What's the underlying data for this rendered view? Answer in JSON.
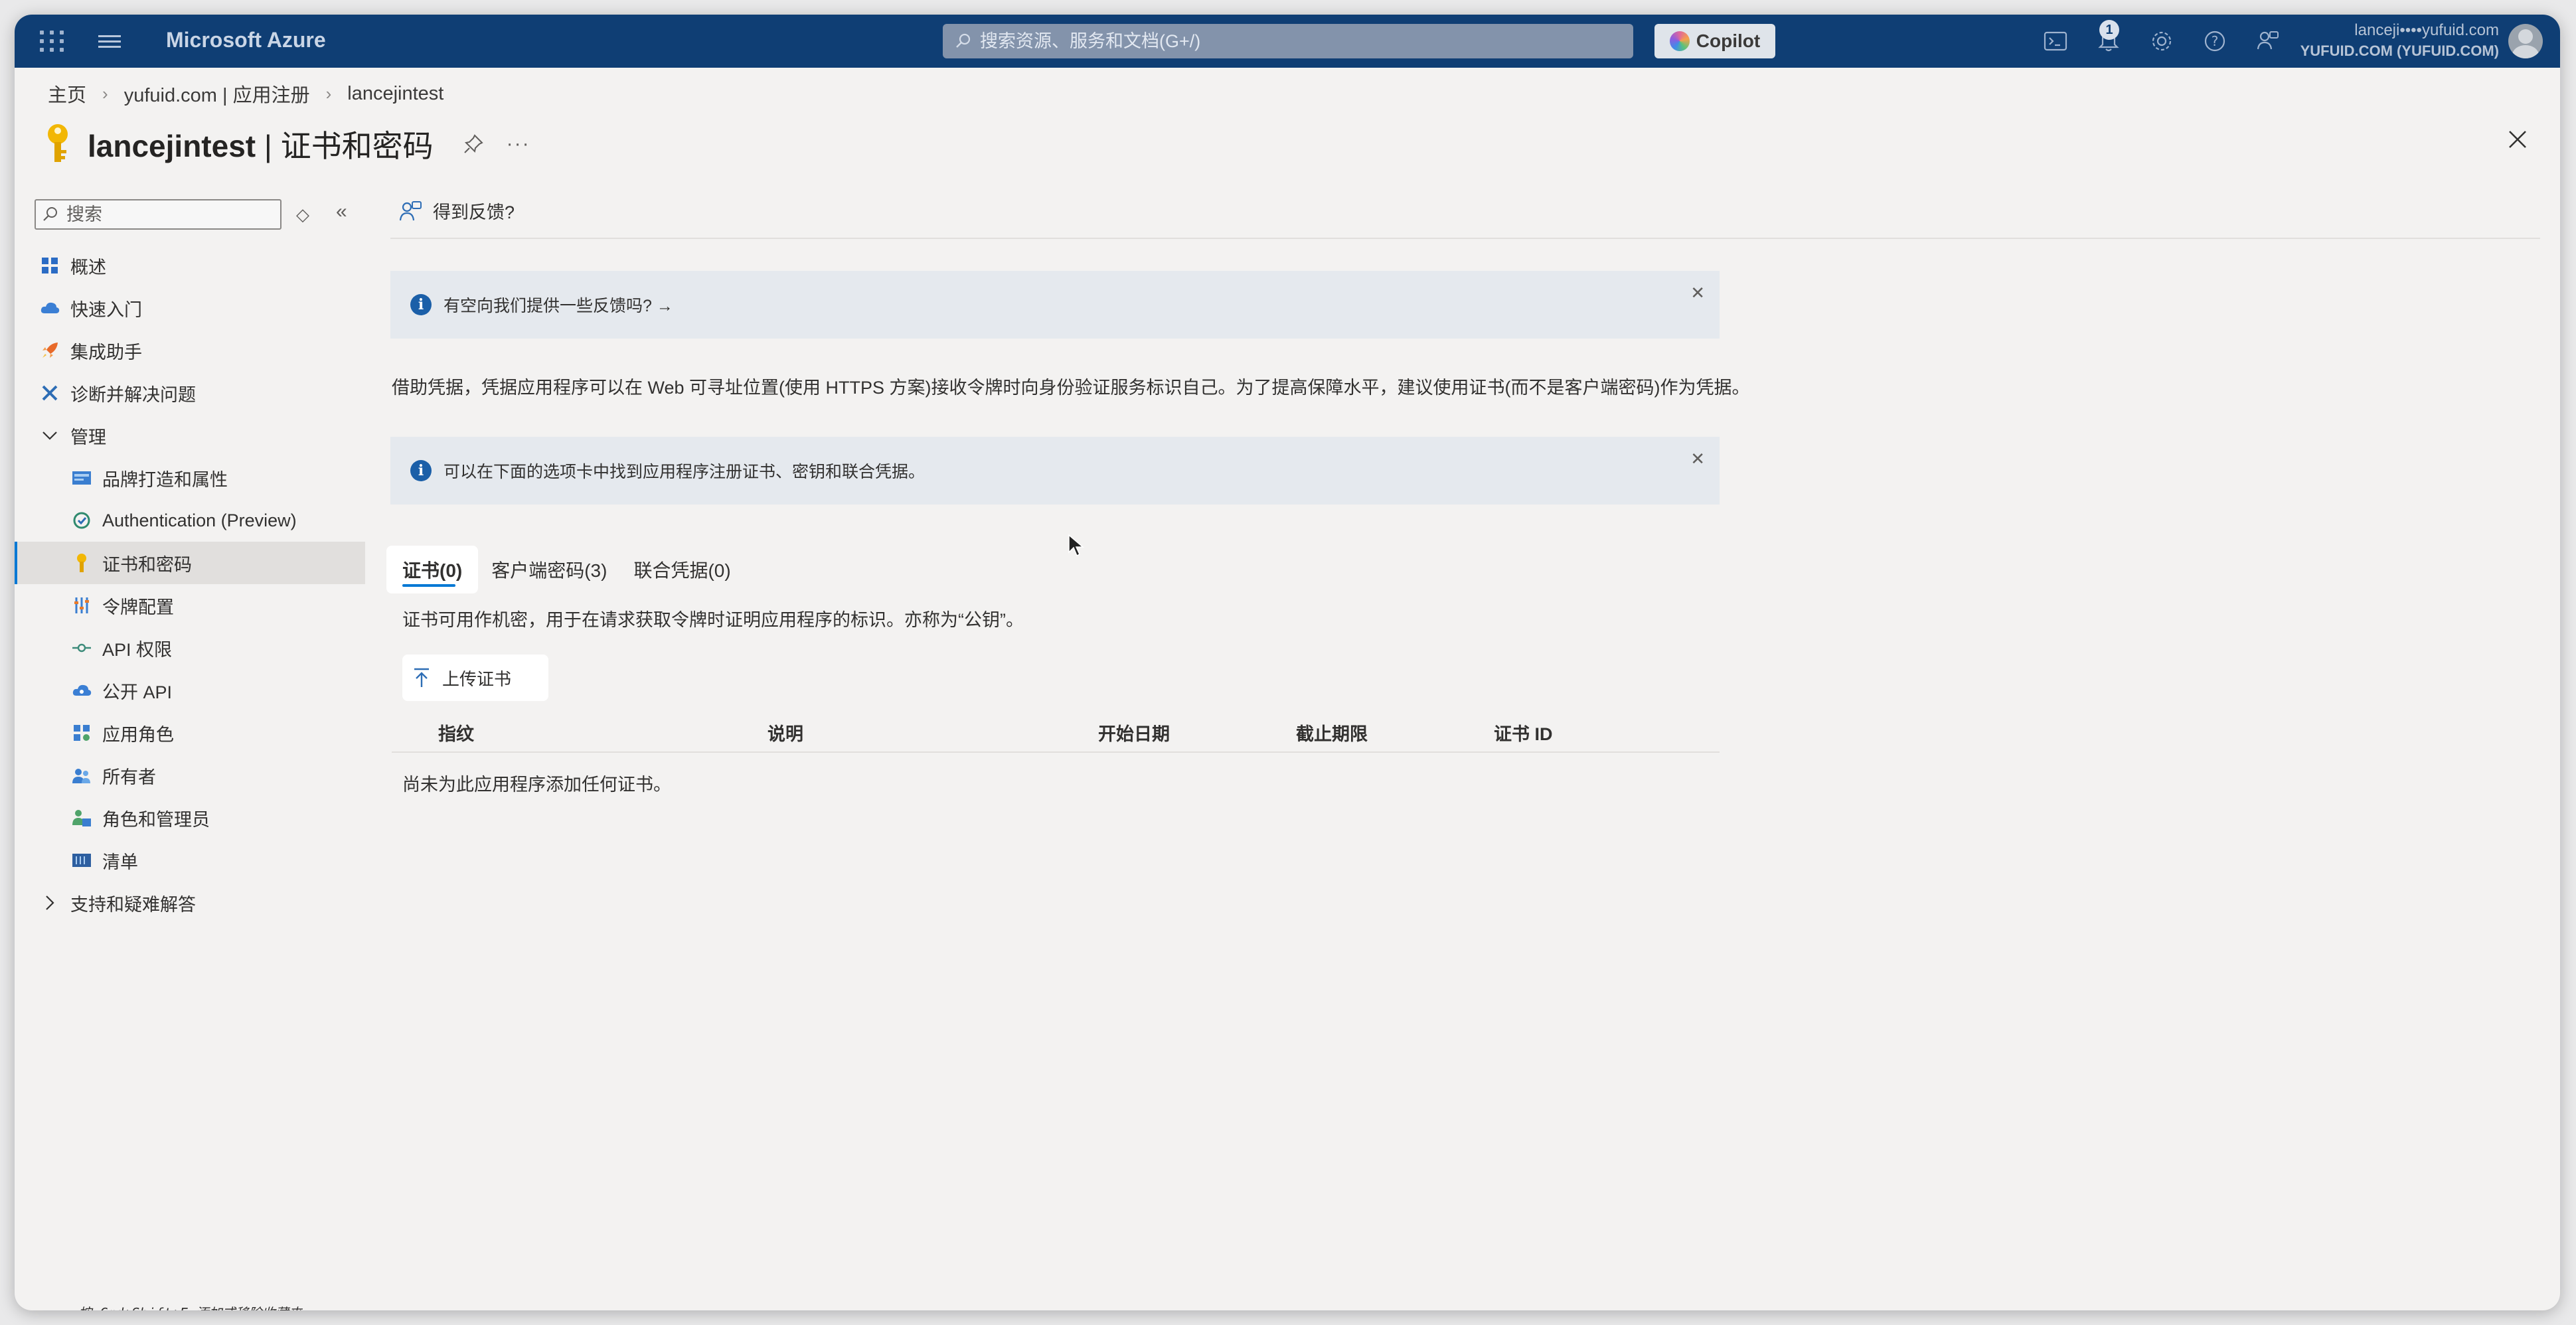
{
  "topbar": {
    "brand": "Microsoft Azure",
    "search_placeholder": "搜索资源、服务和文档(G+/)",
    "copilot_label": "Copilot",
    "notification_count": "1",
    "account_line1": "lanceji••••yufuid.com",
    "account_line2": "YUFUID.COM (YUFUID.COM)"
  },
  "breadcrumb": [
    "主页",
    "yufuid.com | 应用注册",
    "lancejintest"
  ],
  "page": {
    "title_app": "lancejintest",
    "title_section": " | 证书和密码"
  },
  "sidebar": {
    "search_placeholder": "搜索",
    "items": [
      {
        "label": "概述",
        "icon": "grid-icon"
      },
      {
        "label": "快速入门",
        "icon": "cloud-icon"
      },
      {
        "label": "集成助手",
        "icon": "rocket-icon"
      },
      {
        "label": "诊断并解决问题",
        "icon": "wrench-icon"
      },
      {
        "label": "管理",
        "icon": "chevron-down-icon"
      },
      {
        "label": "品牌打造和属性",
        "icon": "branding-icon"
      },
      {
        "label": "Authentication (Preview)",
        "icon": "auth-icon"
      },
      {
        "label": "证书和密码",
        "icon": "key-icon"
      },
      {
        "label": "令牌配置",
        "icon": "token-icon"
      },
      {
        "label": "API 权限",
        "icon": "api-permission-icon"
      },
      {
        "label": "公开 API",
        "icon": "cloud-api-icon"
      },
      {
        "label": "应用角色",
        "icon": "app-roles-icon"
      },
      {
        "label": "所有者",
        "icon": "owners-icon"
      },
      {
        "label": "角色和管理员",
        "icon": "roles-admins-icon"
      },
      {
        "label": "清单",
        "icon": "manifest-icon"
      },
      {
        "label": "支持和疑难解答",
        "icon": "chevron-right-icon"
      }
    ]
  },
  "main": {
    "feedback_label": "得到反馈?",
    "banner1_text": "有空向我们提供一些反馈吗? →",
    "description": "借助凭据，凭据应用程序可以在 Web 可寻址位置(使用 HTTPS 方案)接收令牌时向身份验证服务标识自己。为了提高保障水平，建议使用证书(而不是客户端密码)作为凭据。",
    "banner2_text": "可以在下面的选项卡中找到应用程序注册证书、密钥和联合凭据。",
    "tabs": [
      "证书(0)",
      "客户端密码(3)",
      "联合凭据(0)"
    ],
    "tab_description": "证书可用作机密，用于在请求获取令牌时证明应用程序的标识。亦称为“公钥”。",
    "upload_label": "上传证书",
    "table_headers": [
      "指纹",
      "说明",
      "开始日期",
      "截止期限",
      "证书 ID"
    ],
    "empty_text": "尚未为此应用程序添加任何证书。"
  },
  "footer_hint": "按 Cmd+Shift+F 添加或移除收藏夹",
  "colors": {
    "topbar": "#0f3e74",
    "accent": "#0078d4",
    "banner": "#e5e9ee"
  }
}
